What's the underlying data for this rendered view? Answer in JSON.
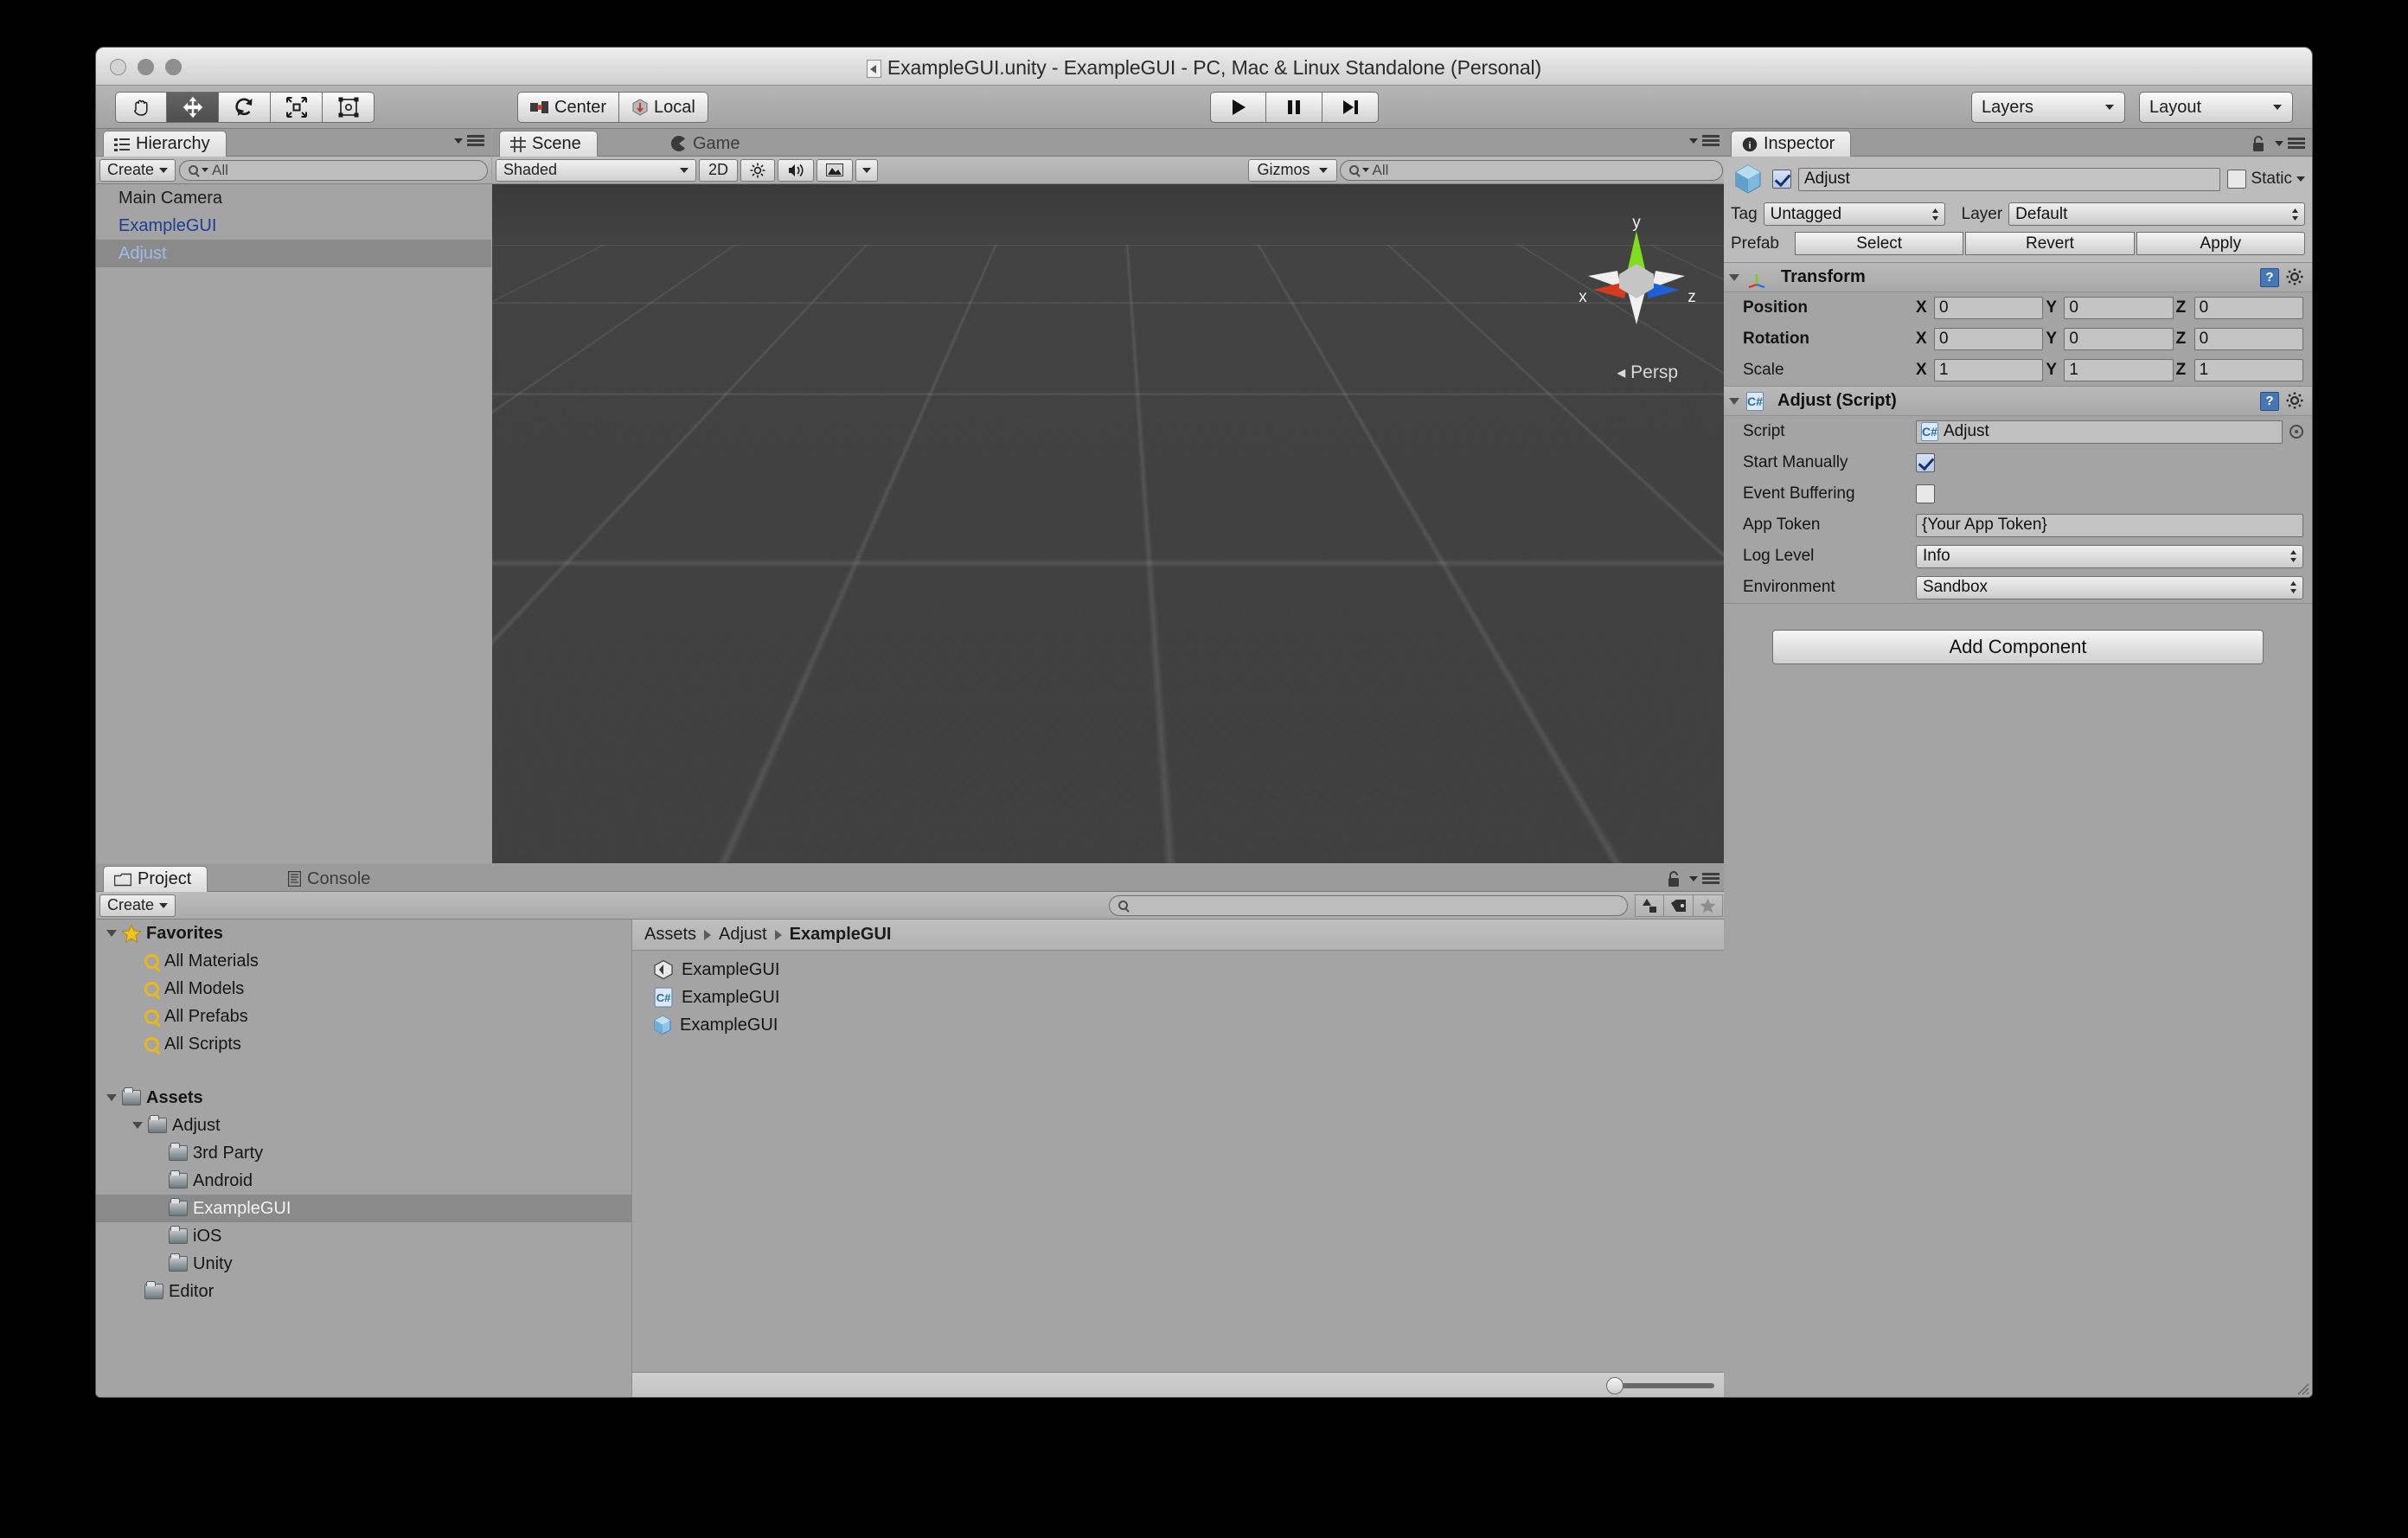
{
  "window": {
    "title": "ExampleGUI.unity - ExampleGUI - PC, Mac & Linux Standalone (Personal)"
  },
  "toolbar": {
    "tools": [
      {
        "name": "hand-tool",
        "icon": "hand",
        "active": false
      },
      {
        "name": "move-tool",
        "icon": "move",
        "active": true
      },
      {
        "name": "rotate-tool",
        "icon": "rotate",
        "active": false
      },
      {
        "name": "scale-tool",
        "icon": "scale",
        "active": false
      },
      {
        "name": "rect-tool",
        "icon": "rect",
        "active": false
      }
    ],
    "pivot_label": "Center",
    "handle_label": "Local",
    "play_label": "play",
    "pause_label": "pause",
    "step_label": "step",
    "layers_label": "Layers",
    "layout_label": "Layout"
  },
  "hierarchy": {
    "tab_label": "Hierarchy",
    "create_label": "Create",
    "search_placeholder": "All",
    "items": [
      {
        "label": "Main Camera",
        "selected": false,
        "prefab": false
      },
      {
        "label": "ExampleGUI",
        "selected": false,
        "prefab": true
      },
      {
        "label": "Adjust",
        "selected": true,
        "prefab": true
      }
    ]
  },
  "scene": {
    "tab_scene": "Scene",
    "tab_game": "Game",
    "shading_mode": "Shaded",
    "mode_2d": "2D",
    "lighting_icon": "sun-icon",
    "audio_icon": "speaker-icon",
    "effects_icon": "image-icon",
    "gizmos_label": "Gizmos",
    "search_placeholder": "All",
    "perspective_label": "Persp",
    "axis_x": "x",
    "axis_y": "y",
    "axis_z": "z"
  },
  "inspector": {
    "tab_label": "Inspector",
    "object_name": "Adjust",
    "enabled": true,
    "static_label": "Static",
    "static_checked": false,
    "tag_label": "Tag",
    "tag_value": "Untagged",
    "layer_label": "Layer",
    "layer_value": "Default",
    "prefab_label": "Prefab",
    "prefab_buttons": [
      "Select",
      "Revert",
      "Apply"
    ],
    "transform": {
      "title": "Transform",
      "rows": [
        {
          "label": "Position",
          "x": "0",
          "y": "0",
          "z": "0"
        },
        {
          "label": "Rotation",
          "x": "0",
          "y": "0",
          "z": "0"
        },
        {
          "label": "Scale",
          "x": "1",
          "y": "1",
          "z": "1"
        }
      ],
      "axis_labels": [
        "X",
        "Y",
        "Z"
      ]
    },
    "script_component": {
      "title": "Adjust (Script)",
      "script_label": "Script",
      "script_value": "Adjust",
      "start_manually_label": "Start Manually",
      "start_manually_checked": true,
      "event_buffering_label": "Event Buffering",
      "event_buffering_checked": false,
      "app_token_label": "App Token",
      "app_token_value": "{Your App Token}",
      "log_level_label": "Log Level",
      "log_level_value": "Info",
      "environment_label": "Environment",
      "environment_value": "Sandbox"
    },
    "add_component_label": "Add Component"
  },
  "project": {
    "tab_project": "Project",
    "tab_console": "Console",
    "create_label": "Create",
    "search_placeholder": "",
    "tree": [
      {
        "label": "Favorites",
        "depth": 0,
        "icon": "star",
        "bold": true,
        "expanded": true,
        "selected": false
      },
      {
        "label": "All Materials",
        "depth": 1,
        "icon": "search",
        "bold": false,
        "expanded": null,
        "selected": false
      },
      {
        "label": "All Models",
        "depth": 1,
        "icon": "search",
        "bold": false,
        "expanded": null,
        "selected": false
      },
      {
        "label": "All Prefabs",
        "depth": 1,
        "icon": "search",
        "bold": false,
        "expanded": null,
        "selected": false
      },
      {
        "label": "All Scripts",
        "depth": 1,
        "icon": "search",
        "bold": false,
        "expanded": null,
        "selected": false
      },
      {
        "label": "",
        "depth": 0,
        "icon": "none",
        "bold": false,
        "expanded": null,
        "selected": false
      },
      {
        "label": "Assets",
        "depth": 0,
        "icon": "folder",
        "bold": true,
        "expanded": true,
        "selected": false
      },
      {
        "label": "Adjust",
        "depth": 1,
        "icon": "folder",
        "bold": false,
        "expanded": true,
        "selected": false
      },
      {
        "label": "3rd Party",
        "depth": 2,
        "icon": "folder",
        "bold": false,
        "expanded": null,
        "selected": false
      },
      {
        "label": "Android",
        "depth": 2,
        "icon": "folder",
        "bold": false,
        "expanded": null,
        "selected": false
      },
      {
        "label": "ExampleGUI",
        "depth": 2,
        "icon": "folder",
        "bold": false,
        "expanded": null,
        "selected": true
      },
      {
        "label": "iOS",
        "depth": 2,
        "icon": "folder",
        "bold": false,
        "expanded": null,
        "selected": false
      },
      {
        "label": "Unity",
        "depth": 2,
        "icon": "folder",
        "bold": false,
        "expanded": null,
        "selected": false
      },
      {
        "label": "Editor",
        "depth": 1,
        "icon": "folder",
        "bold": false,
        "expanded": null,
        "selected": false
      }
    ],
    "breadcrumb": [
      "Assets",
      "Adjust",
      "ExampleGUI"
    ],
    "assets": [
      {
        "label": "ExampleGUI",
        "icon": "unity-scene"
      },
      {
        "label": "ExampleGUI",
        "icon": "csharp-script"
      },
      {
        "label": "ExampleGUI",
        "icon": "prefab"
      }
    ]
  },
  "colors": {
    "chrome": "#a8a8a8",
    "panel": "#a4a4a4",
    "selection": "#8a8a8a",
    "prefab_text": "#1d3f8f",
    "scene_bg": "#3b3b3b",
    "axis_x": "#e03010",
    "axis_y": "#76d219",
    "axis_z": "#1a6ee8"
  }
}
